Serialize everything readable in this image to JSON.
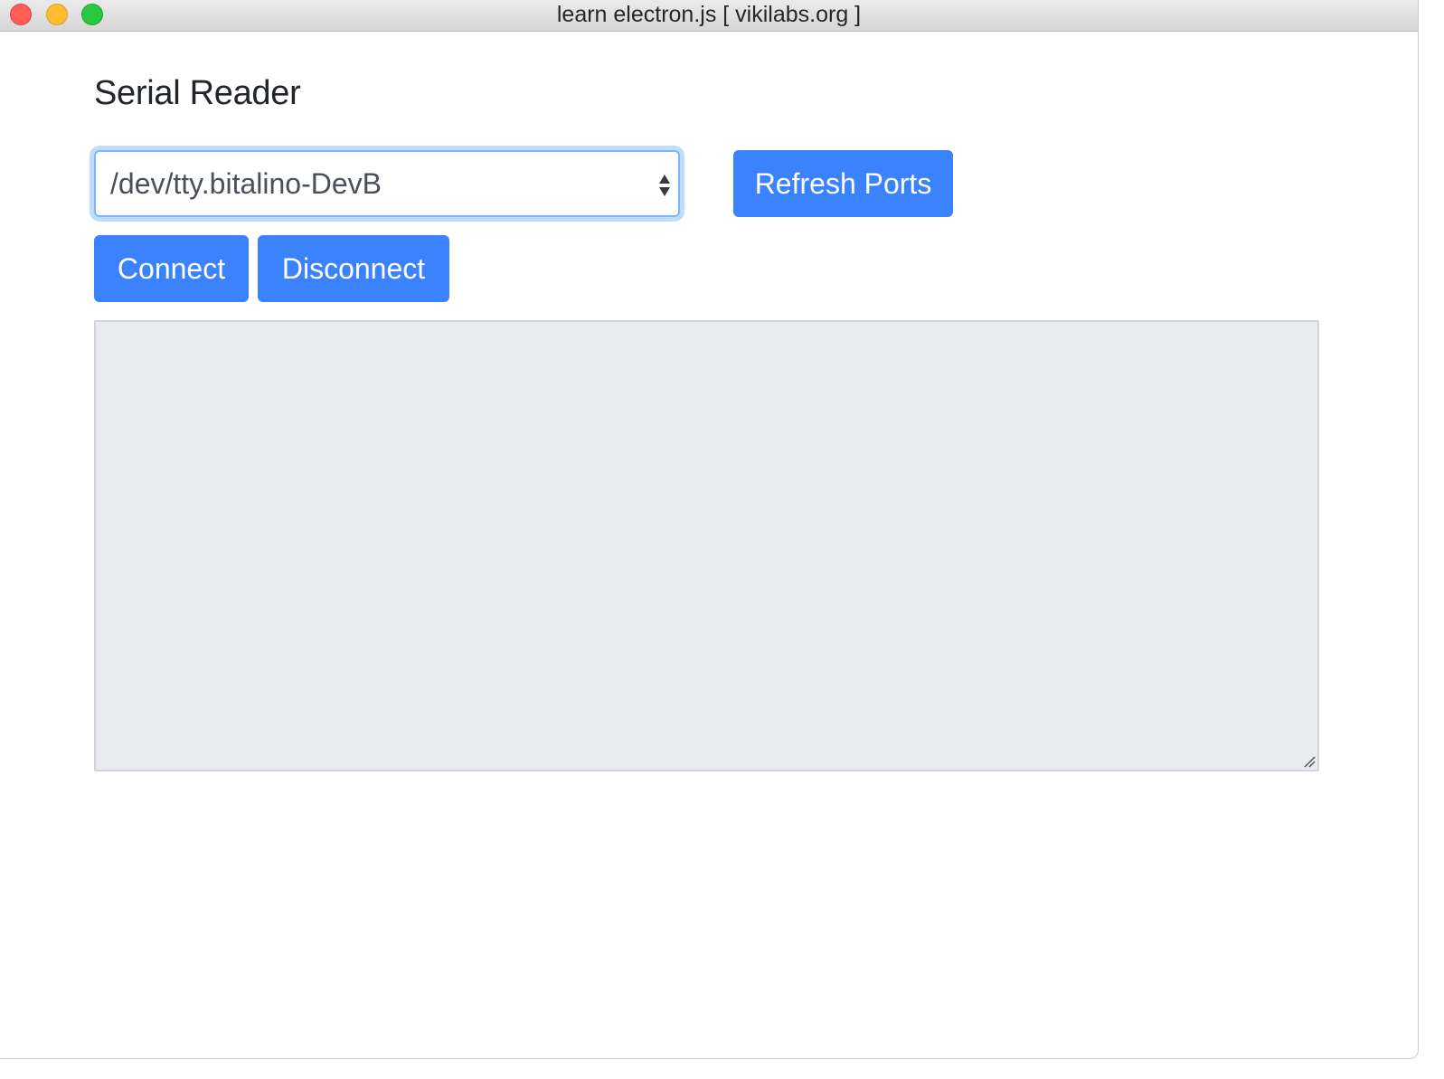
{
  "window": {
    "title": "learn electron.js [ vikilabs.org ]"
  },
  "main": {
    "heading": "Serial Reader",
    "port_select": {
      "selected": "/dev/tty.bitalino-DevB",
      "icon": "updown-arrows-icon"
    },
    "buttons": {
      "refresh_label": "Refresh Ports",
      "connect_label": "Connect",
      "disconnect_label": "Disconnect"
    },
    "output": {
      "value": ""
    }
  },
  "colors": {
    "primary_button": "#3b82fe",
    "select_focus_border": "#80b3ff",
    "output_background": "#e9eaee"
  }
}
